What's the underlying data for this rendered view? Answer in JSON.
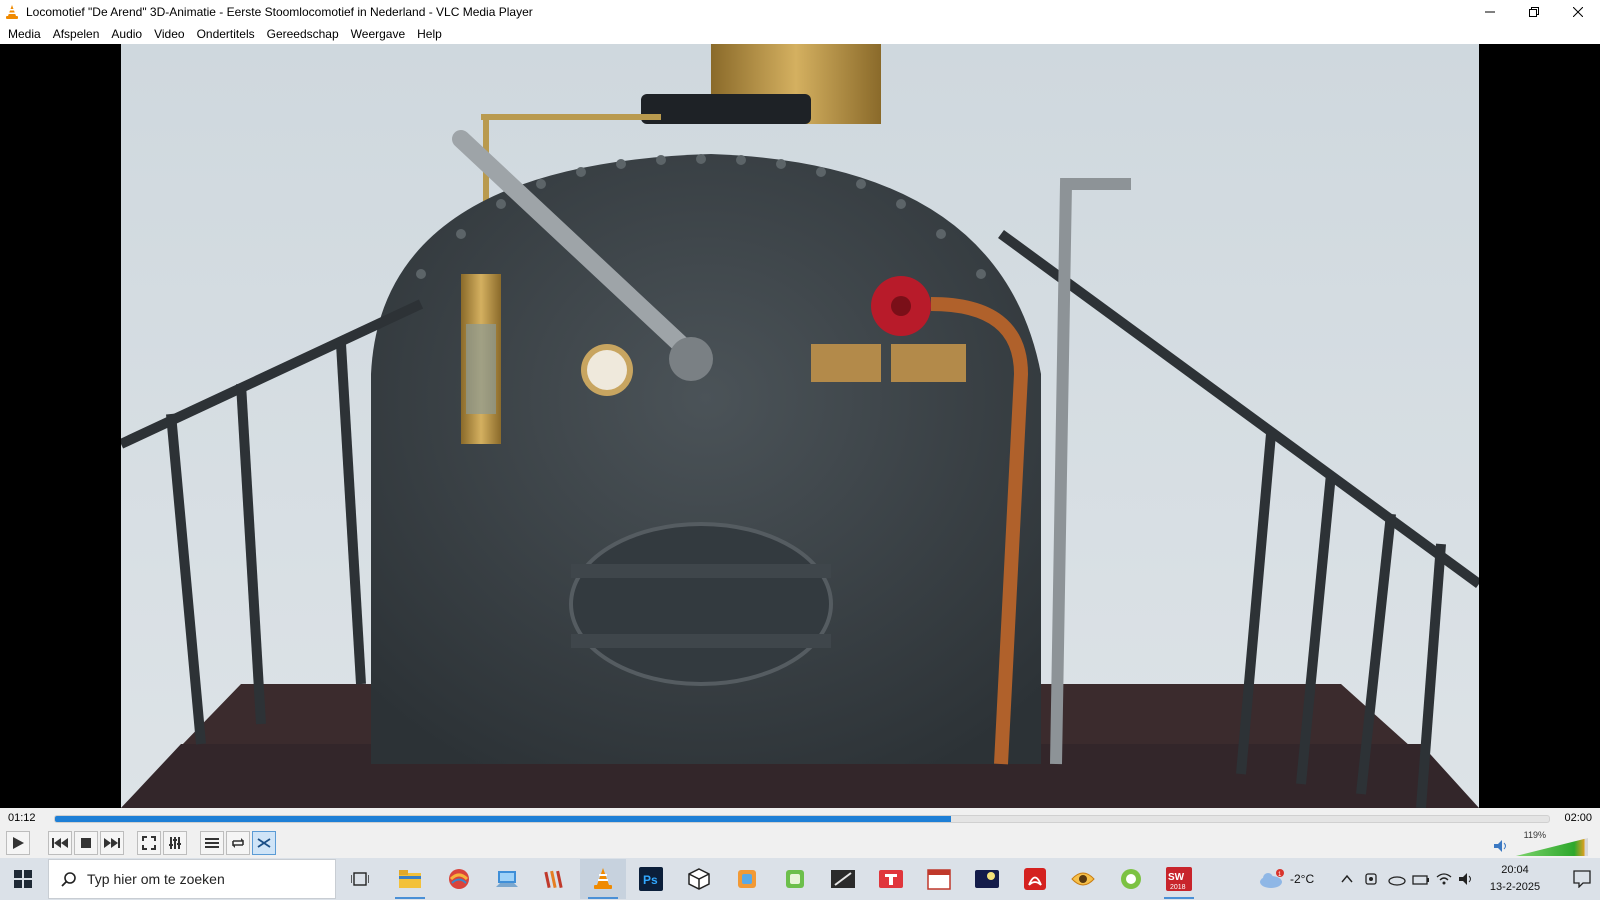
{
  "window": {
    "title": "Locomotief \"De Arend\" 3D-Animatie - Eerste Stoomlocomotief in Nederland - VLC Media Player"
  },
  "menu": [
    "Media",
    "Afspelen",
    "Audio",
    "Video",
    "Ondertitels",
    "Gereedschap",
    "Weergave",
    "Help"
  ],
  "player": {
    "elapsed": "01:12",
    "total": "02:00",
    "progress": 0.6,
    "volume_percent": "119%",
    "volume_level": 1.19
  },
  "taskbar": {
    "search_placeholder": "Typ hier om te zoeken",
    "weather_temp": "-2°C",
    "weather_badge": "1",
    "clock_time": "20:04",
    "clock_date": "13-2-2025",
    "apps": [
      {
        "name": "task-view-icon"
      },
      {
        "name": "file-explorer-icon"
      },
      {
        "name": "app-red-orb-icon"
      },
      {
        "name": "remote-desktop-icon"
      },
      {
        "name": "books-library-icon"
      },
      {
        "name": "vlc-cone-icon"
      },
      {
        "name": "photoshop-icon"
      },
      {
        "name": "3d-cube-icon"
      },
      {
        "name": "app-s-orange-icon"
      },
      {
        "name": "app-p-green-icon"
      },
      {
        "name": "pen-tool-icon"
      },
      {
        "name": "app-t-red-icon"
      },
      {
        "name": "solidworks-calendar-icon"
      },
      {
        "name": "night-sky-icon"
      },
      {
        "name": "acrobat-icon"
      },
      {
        "name": "eye-viewer-icon"
      },
      {
        "name": "green-circle-app-icon"
      },
      {
        "name": "solidworks-icon"
      }
    ],
    "app_labels": {
      "photoshop": "Ps",
      "solidworks": "SW",
      "solidworks_year": "2018"
    }
  },
  "colors": {
    "accent": "#1e7fd6",
    "vlc_orange": "#f08a00"
  }
}
